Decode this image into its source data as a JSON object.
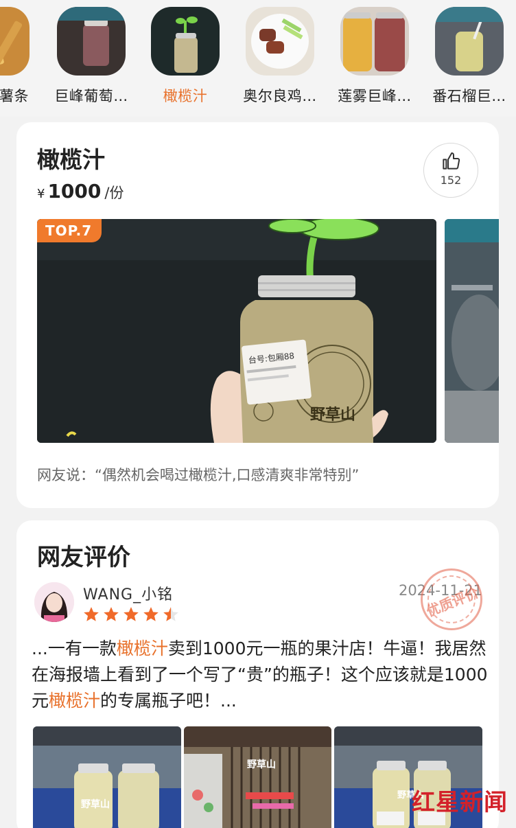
{
  "strip": {
    "items": [
      {
        "label": "薯条",
        "active": false
      },
      {
        "label": "巨峰葡萄…",
        "active": false
      },
      {
        "label": "橄榄汁",
        "active": true
      },
      {
        "label": "奥尔良鸡…",
        "active": false
      },
      {
        "label": "莲雾巨峰…",
        "active": false
      },
      {
        "label": "番石榴巨…",
        "active": false
      }
    ]
  },
  "dish": {
    "title": "橄榄汁",
    "currency": "¥",
    "price": "1000",
    "unit": "/份",
    "likes": "152",
    "badge": "TOP.7",
    "bottle_brand": "野草山",
    "bottle_label": "台号:包厢88",
    "quote": "网友说：“偶然机会喝过橄榄汁,口感清爽非常特别”"
  },
  "reviews": {
    "title": "网友评价",
    "item": {
      "username": "WANG_小铭",
      "date": "2024-11-21",
      "rating": 4.5,
      "stamp": "优质评价",
      "text_parts": [
        {
          "t": "...一有一款",
          "hl": false
        },
        {
          "t": "橄榄汁",
          "hl": true
        },
        {
          "t": "卖到1000元一瓶的果汁店！牛逼！我居然在海报墙上看到了一个写了“贵”的瓶子！这个应该就是1000元",
          "hl": false
        },
        {
          "t": "橄榄汁",
          "hl": true
        },
        {
          "t": "的专属瓶子吧！...",
          "hl": false
        }
      ]
    }
  },
  "watermark": {
    "text": "红星新闻"
  },
  "colors": {
    "accent": "#e8712b",
    "star": "#f06a2a",
    "watermark": "#d3212a"
  }
}
